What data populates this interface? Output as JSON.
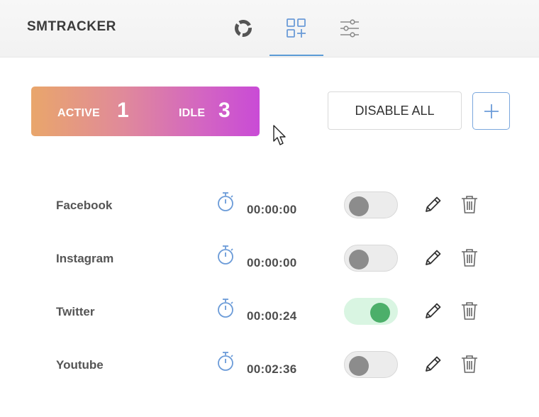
{
  "app": {
    "title": "SMTRACKER"
  },
  "nav": {
    "tabs": [
      {
        "icon": "donut-chart-icon",
        "active": false
      },
      {
        "icon": "add-grid-icon",
        "active": true
      },
      {
        "icon": "sliders-icon",
        "active": false
      }
    ]
  },
  "summary": {
    "active_label": "ACTIVE",
    "active_count": "1",
    "idle_label": "IDLE",
    "idle_count": "3"
  },
  "toolbar": {
    "disable_all_label": "DISABLE ALL",
    "add_icon": "plus-icon"
  },
  "trackers": [
    {
      "name": "Facebook",
      "time": "00:00:00",
      "enabled": false
    },
    {
      "name": "Instagram",
      "time": "00:00:00",
      "enabled": false
    },
    {
      "name": "Twitter",
      "time": "00:00:24",
      "enabled": true
    },
    {
      "name": "Youtube",
      "time": "00:02:36",
      "enabled": false
    }
  ],
  "colors": {
    "accent_blue": "#5b9bd5",
    "toggle_on": "#4caf6a",
    "gradient_start": "#e9a66b",
    "gradient_end": "#c94bd6"
  }
}
